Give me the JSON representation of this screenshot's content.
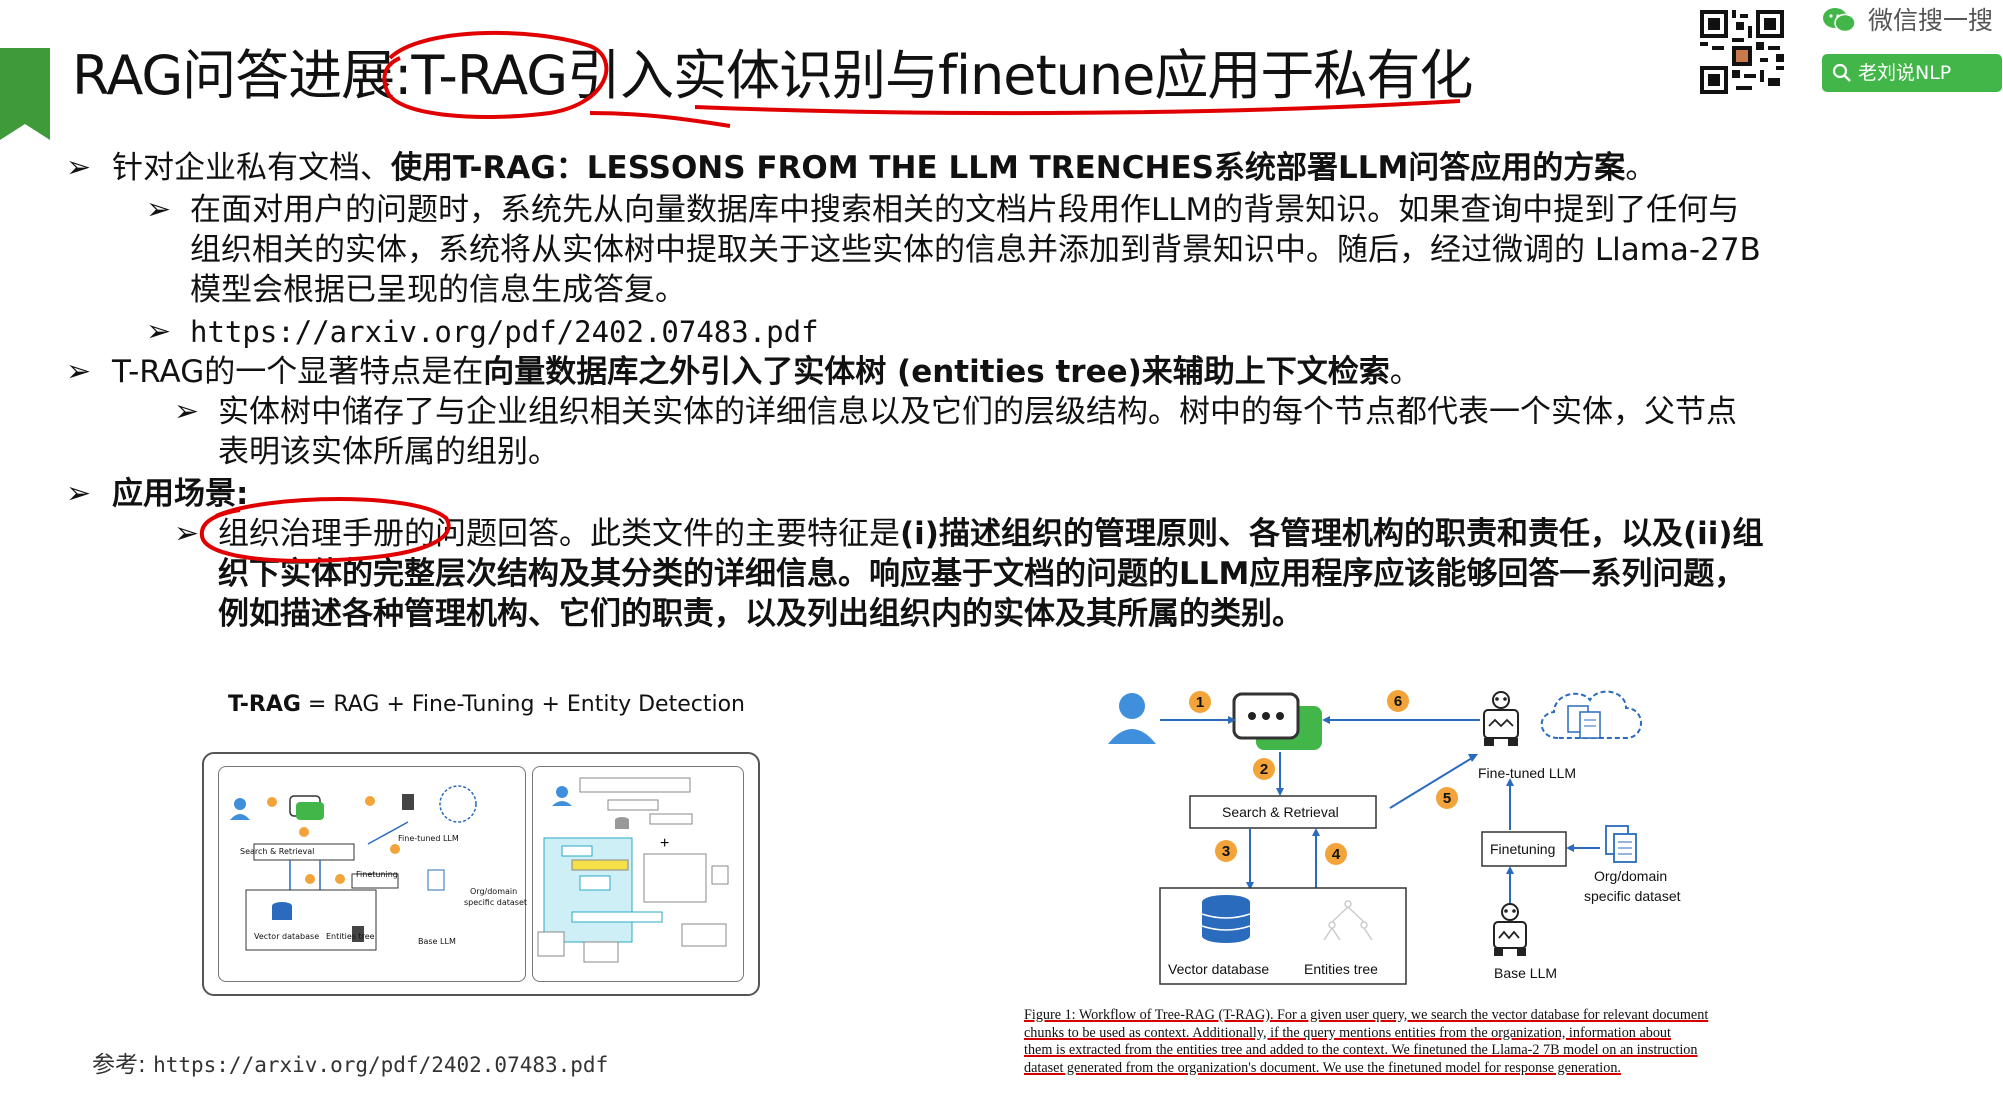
{
  "header": {
    "title": "RAG问答进展:T-RAG引入实体识别与finetune应用于私有化",
    "wechat_label": "微信搜一搜",
    "search_label": "老刘说NLP"
  },
  "bullets": [
    {
      "pre": "针对企业私有文档、",
      "bold": "使用T-RAG：LESSONS FROM THE LLM TRENCHES系统部署LLM问答应用的方案",
      "post": "。"
    },
    {
      "line1": "在面对用户的问题时，系统先从向量数据库中搜索相关的文档片段用作LLM的背景知识。如果查询中提到了任何与",
      "line2": "组织相关的实体，系统将从实体树中提取关于这些实体的信息并添加到背景知识中。随后，经过微调的 Llama-27B",
      "line3": "模型会根据已呈现的信息生成答复。"
    },
    {
      "text": "https://arxiv.org/pdf/2402.07483.pdf"
    },
    {
      "pre": "T-RAG的一个显著特点是在",
      "bold": "向量数据库之外引入了实体树 (entities tree)来辅助上下文检索",
      "post": "。"
    },
    {
      "line1": "实体树中储存了与企业组织相关实体的详细信息以及它们的层级结构。树中的每个节点都代表一个实体，父节点",
      "line2": "表明该实体所属的组别。"
    },
    {
      "text": "应用场景:"
    },
    {
      "pre": "组织治理手册的问题回答。此类文件的主要特征是",
      "bold": "(i)描述组织的管理原则、各管理机构的职责和责任，以及(ii)组",
      "line2": "织下实体的完整层次结构及其分类的详细信息。响应基于文档的问题的LLM应用程序应该能够回答一系列问题，",
      "line3": "例如描述各种管理机构、它们的职责，以及列出组织内的实体及其所属的类别。"
    }
  ],
  "left_figure": {
    "title_bold": "T-RAG",
    "title_rest": " = RAG + Fine-Tuning + Entity Detection",
    "search": "Search & Retrieval",
    "finetuned": "Fine-tuned LLM",
    "finetuning": "Finetuning",
    "org": "Org/domain",
    "org2": "specific dataset",
    "vector": "Vector database",
    "entities": "Entities tree",
    "base": "Base LLM"
  },
  "right_figure": {
    "steps": [
      "1",
      "2",
      "3",
      "4",
      "5",
      "6"
    ],
    "search": "Search & Retrieval",
    "finetuned": "Fine-tuned LLM",
    "finetuning": "Finetuning",
    "org": "Org/domain",
    "org2": "specific dataset",
    "vector": "Vector database",
    "entities": "Entities tree",
    "base": "Base LLM"
  },
  "caption": {
    "line1": "Figure 1: Workflow of Tree-RAG (T-RAG). For a given user query, we search the vector database for relevant document",
    "line2": "chunks to be used as context. Additionally, if the query mentions entities from the organization, information about",
    "line3": "them is extracted from the entities tree and added to the context. We finetuned the Llama-2 7B model on an instruction",
    "line4": "dataset generated from the organization's document. We use the finetuned model for response generation."
  },
  "reference": {
    "label": "参考:",
    "url": "https://arxiv.org/pdf/2402.07483.pdf"
  },
  "colors": {
    "accent_green": "#3f9a3a",
    "annotation_red": "#e00000",
    "icon_blue": "#3f8fdc",
    "badge_orange": "#f2a33a"
  }
}
